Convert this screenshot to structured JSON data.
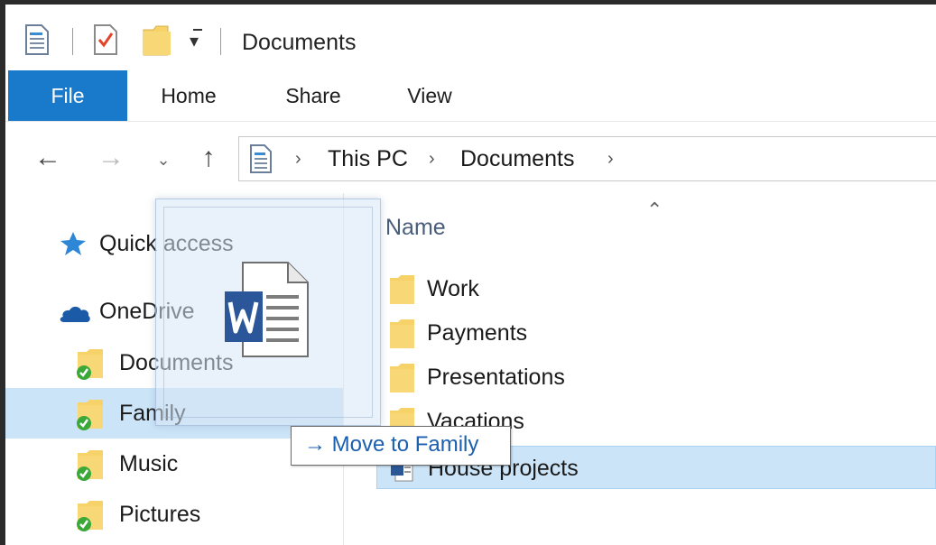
{
  "window": {
    "title": "Documents"
  },
  "ribbon": {
    "tabs": [
      {
        "label": "File"
      },
      {
        "label": "Home"
      },
      {
        "label": "Share"
      },
      {
        "label": "View"
      }
    ]
  },
  "address": {
    "crumbs": [
      "This PC",
      "Documents"
    ]
  },
  "nav": {
    "items": [
      {
        "label": "Quick access",
        "icon": "star-icon"
      },
      {
        "label": "OneDrive",
        "icon": "cloud-icon"
      },
      {
        "label": "Documents",
        "icon": "synced-folder-icon"
      },
      {
        "label": "Family",
        "icon": "synced-folder-icon"
      },
      {
        "label": "Music",
        "icon": "synced-folder-icon"
      },
      {
        "label": "Pictures",
        "icon": "synced-folder-icon"
      }
    ]
  },
  "content": {
    "column_header": "Name",
    "rows": [
      {
        "label": "Work",
        "icon": "folder-icon"
      },
      {
        "label": "Payments",
        "icon": "folder-icon"
      },
      {
        "label": "Presentations",
        "icon": "folder-icon"
      },
      {
        "label": "Vacations",
        "icon": "folder-icon"
      },
      {
        "label": "House projects",
        "icon": "word-document-icon"
      }
    ]
  },
  "drag": {
    "tooltip_arrow": "→",
    "tooltip_text": "Move to Family",
    "icon": "word-document-icon"
  },
  "colors": {
    "file_tab": "#1979ca",
    "selection": "#cce4f7",
    "folder": "#f8d776",
    "sync_check": "#3aa93a",
    "tooltip_text": "#1b5fb0"
  }
}
